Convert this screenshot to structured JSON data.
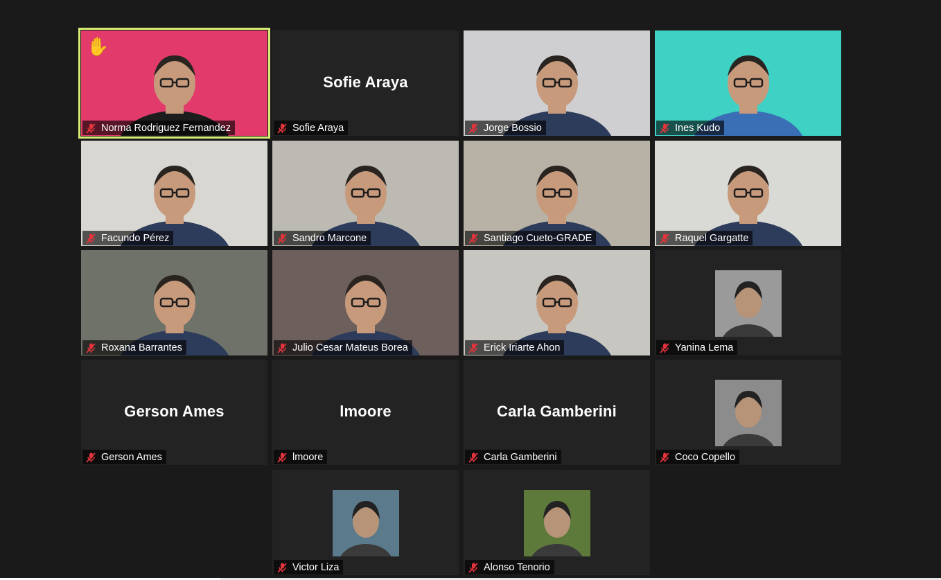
{
  "participants": [
    {
      "name": "Norma Rodriguez Fernandez",
      "display": "video",
      "speaking": true,
      "hand_raised": true,
      "bg": "#e23b6b"
    },
    {
      "name": "Sofie Araya",
      "display": "name",
      "center_name": "Sofie Araya"
    },
    {
      "name": "Jorge Bossio",
      "display": "video",
      "bg": "#cfcfd2"
    },
    {
      "name": "Ines Kudo",
      "display": "video",
      "bg": "#3fd2c4"
    },
    {
      "name": "Facundo Pérez",
      "display": "video",
      "bg": "#d8d7d2"
    },
    {
      "name": "Sandro Marcone",
      "display": "video",
      "bg": "#bcbab3"
    },
    {
      "name": "Santiago Cueto-GRADE",
      "display": "video",
      "bg": "#b8b2a6"
    },
    {
      "name": "Raquel Gargatte",
      "display": "video",
      "bg": "#d9d9d6"
    },
    {
      "name": "Roxana Barrantes",
      "display": "video",
      "bg": "#6f7268"
    },
    {
      "name": "Julio Cesar Mateus Borea",
      "display": "video",
      "bg": "#6d5f5c"
    },
    {
      "name": "Erick Iriarte Ahon",
      "display": "video",
      "bg": "#c8c6c0"
    },
    {
      "name": "Yanina Lema",
      "display": "photo",
      "photo_bg": "#9a9a9a"
    },
    {
      "name": "Gerson Ames",
      "display": "name",
      "center_name": "Gerson Ames"
    },
    {
      "name": "lmoore",
      "display": "name",
      "center_name": "lmoore"
    },
    {
      "name": "Carla Gamberini",
      "display": "name",
      "center_name": "Carla Gamberini"
    },
    {
      "name": "Coco Copello",
      "display": "photo",
      "photo_bg": "#8c8c8c"
    },
    {
      "name": "Victor Liza",
      "display": "photo",
      "photo_bg": "#5b7a8c"
    },
    {
      "name": "Alonso Tenorio",
      "display": "photo",
      "photo_bg": "#5d7a3a"
    }
  ],
  "colors": {
    "background": "#1a1a1a",
    "tile": "#232323",
    "active_speaker_border": "#d4ec73",
    "muted_icon": "#e5343c"
  },
  "icons": {
    "muted": "microphone-muted-icon",
    "hand": "raised-hand-icon"
  }
}
